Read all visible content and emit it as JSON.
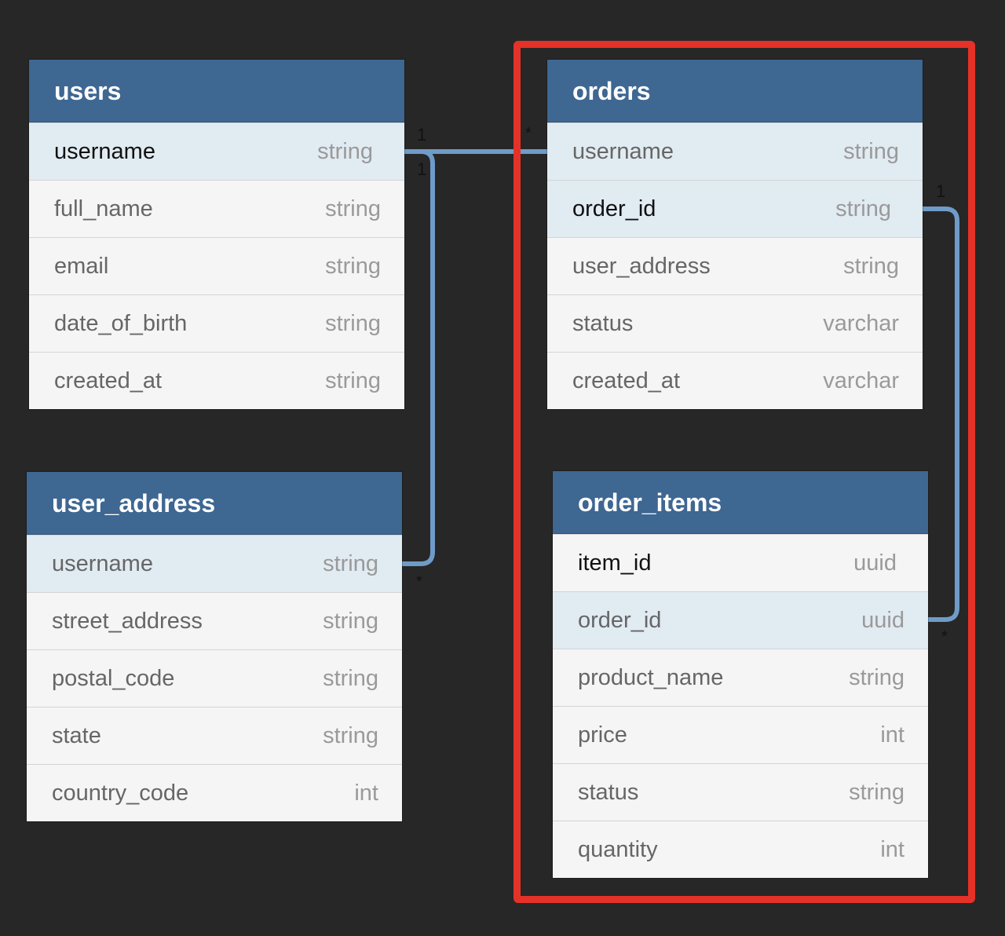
{
  "tables": {
    "users": {
      "name": "users",
      "fields": [
        {
          "name": "username",
          "type": "string"
        },
        {
          "name": "full_name",
          "type": "string"
        },
        {
          "name": "email",
          "type": "string"
        },
        {
          "name": "date_of_birth",
          "type": "string"
        },
        {
          "name": "created_at",
          "type": "string"
        }
      ]
    },
    "user_address": {
      "name": "user_address",
      "fields": [
        {
          "name": "username",
          "type": "string"
        },
        {
          "name": "street_address",
          "type": "string"
        },
        {
          "name": "postal_code",
          "type": "string"
        },
        {
          "name": "state",
          "type": "string"
        },
        {
          "name": "country_code",
          "type": "int"
        }
      ]
    },
    "orders": {
      "name": "orders",
      "fields": [
        {
          "name": "username",
          "type": "string"
        },
        {
          "name": "order_id",
          "type": "string"
        },
        {
          "name": "user_address",
          "type": "string"
        },
        {
          "name": "status",
          "type": "varchar"
        },
        {
          "name": "created_at",
          "type": "varchar"
        }
      ]
    },
    "order_items": {
      "name": "order_items",
      "fields": [
        {
          "name": "item_id",
          "type": "uuid"
        },
        {
          "name": "order_id",
          "type": "uuid"
        },
        {
          "name": "product_name",
          "type": "string"
        },
        {
          "name": "price",
          "type": "int"
        },
        {
          "name": "status",
          "type": "string"
        },
        {
          "name": "quantity",
          "type": "int"
        }
      ]
    }
  },
  "relationships": [
    {
      "from": "users.username",
      "to": "orders.username",
      "from_cardinality": "1",
      "to_cardinality": "*"
    },
    {
      "from": "users.username",
      "to": "user_address.username",
      "from_cardinality": "1",
      "to_cardinality": "*"
    },
    {
      "from": "orders.order_id",
      "to": "order_items.order_id",
      "from_cardinality": "1",
      "to_cardinality": "*"
    }
  ],
  "colors": {
    "background": "#272727",
    "header": "#3e6792",
    "row": "#f5f5f5",
    "row_highlight": "#e1ebf2",
    "connector": "#6f9bc8",
    "highlight_box": "#e53228"
  }
}
